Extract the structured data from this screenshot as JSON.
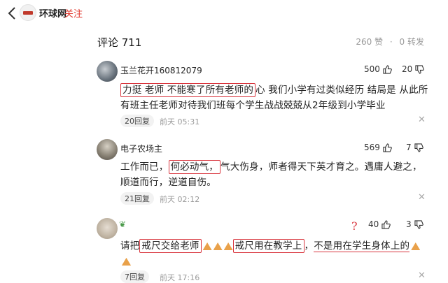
{
  "header": {
    "source_name": "环球网",
    "follow_label": "关注"
  },
  "comments_header": {
    "title": "评论 711",
    "likes": "260 赞",
    "reposts": "0 转发"
  },
  "comments": [
    {
      "username": "玉兰花开160812079",
      "likes": "500",
      "dislikes": "20",
      "text_boxed": "力挺 老师 不能寒了所有老师的",
      "text_rest": "心 我们小学有过类似经历 结局是 从此所有班主任老师对待我们班每个学生战战兢兢从2年级到小学毕业",
      "replies": "20回复",
      "time": "前天 05:31"
    },
    {
      "username": "电子农场主",
      "likes": "569",
      "dislikes": "7",
      "text_pre": "工作而已，",
      "text_boxed": "何必动气，",
      "text_rest": "气大伤身，师者得天下英才育之。遇庸人避之，顺道而行，逆道自伤。",
      "replies": "21回复",
      "time": "前天 02:12"
    },
    {
      "username": "",
      "likes": "40",
      "dislikes": "3",
      "text_pre": "请把",
      "text_boxed_1": "戒尺交给老师",
      "text_boxed_2": "戒尺用在教学上",
      "text_mid": "，",
      "text_underlined": "不是用在学生身体上的",
      "replies": "7回复",
      "time": "前天 17:16"
    }
  ],
  "annotation": {
    "question_mark": "?"
  },
  "colors": {
    "accent": "#e0352b",
    "annotation_red": "#d9363e",
    "muted": "#999999"
  },
  "icons": [
    "back-arrow-icon",
    "source-logo-icon",
    "thumb-up-icon",
    "thumb-down-icon",
    "close-icon",
    "leaf-icon",
    "praying-hands-icon"
  ]
}
